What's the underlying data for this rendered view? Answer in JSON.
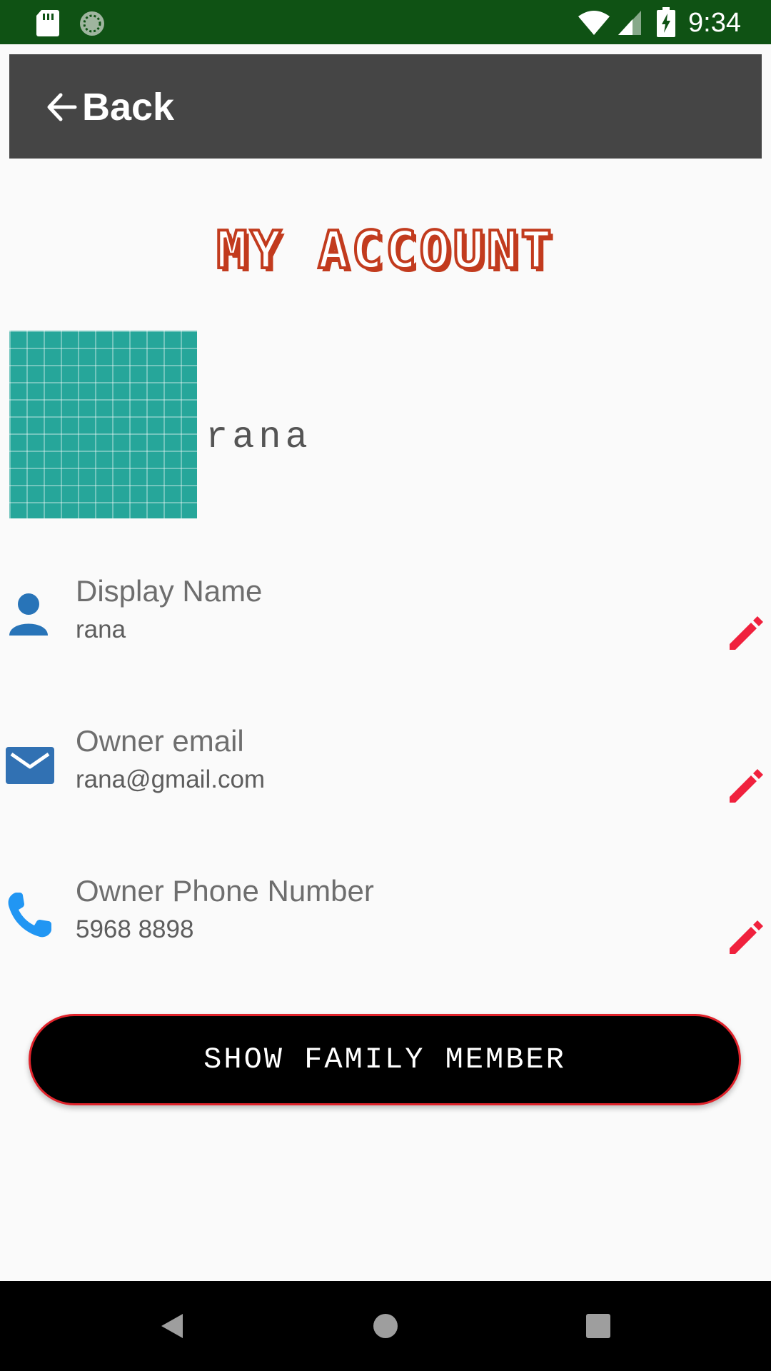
{
  "status_bar": {
    "time": "9:34",
    "icons": [
      "sd-card-icon",
      "sync-icon",
      "wifi-icon",
      "signal-icon",
      "battery-charging-icon"
    ]
  },
  "app_bar": {
    "back_label": "Back"
  },
  "page_title": "MY ACCOUNT",
  "profile": {
    "name": "rana",
    "avatar_color": "#26a69a"
  },
  "fields": [
    {
      "icon": "person-icon",
      "label": "Display Name",
      "value": "rana"
    },
    {
      "icon": "mail-icon",
      "label": "Owner email",
      "value": "rana@gmail.com"
    },
    {
      "icon": "phone-icon",
      "label": "Owner Phone Number",
      "value": "5968 8898"
    }
  ],
  "actions": {
    "show_family_label": "SHOW FAMILY MEMBER"
  },
  "colors": {
    "status_bar": "#0f5214",
    "app_bar": "#454545",
    "title": "#c23b1e",
    "edit_icon": "#f0213d",
    "button_border": "#e0232b"
  },
  "nav_bar": {
    "icons": [
      "back-triangle-icon",
      "home-circle-icon",
      "recents-square-icon"
    ]
  }
}
